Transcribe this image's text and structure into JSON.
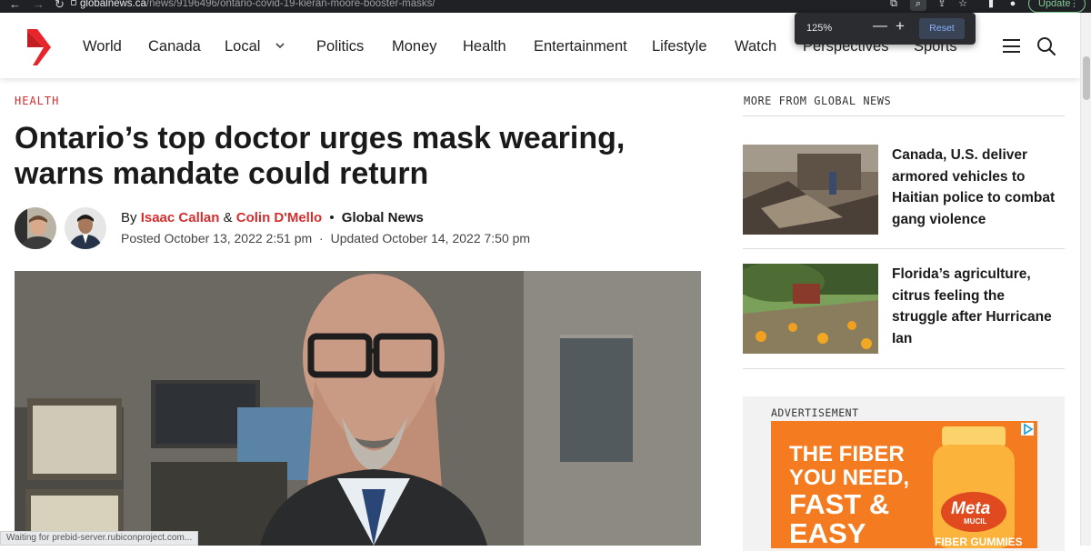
{
  "browser": {
    "url_domain": "globalnews.ca",
    "url_path": "/news/9196496/ontario-covid-19-kieran-moore-booster-masks/",
    "update_label": "Update",
    "zoom_popup": {
      "level": "125%",
      "minus": "—",
      "plus": "+",
      "reset_label": "Reset"
    },
    "status_text": "Waiting for prebid-server.rubiconproject.com..."
  },
  "nav": {
    "items": [
      "World",
      "Canada",
      "Local",
      "Politics",
      "Money",
      "Health",
      "Entertainment",
      "Lifestyle",
      "Watch",
      "Perspectives",
      "Sports"
    ]
  },
  "article": {
    "section": "HEALTH",
    "headline": "Ontario’s top doctor urges mask wearing, warns mandate could return",
    "by_prefix": "By",
    "author1": "Isaac Callan",
    "amp": "&",
    "author2": "Colin D'Mello",
    "bullet": "•",
    "source": "Global News",
    "posted": "Posted October 13, 2022 2:51 pm",
    "separator": "·",
    "updated": "Updated October 14, 2022 7:50 pm"
  },
  "sidebar": {
    "title": "MORE FROM GLOBAL NEWS",
    "stories": [
      {
        "title": "Canada, U.S. deliver armored vehicles to Haitian police to combat gang violence"
      },
      {
        "title": "Florida’s agriculture, citrus feeling the struggle after Hurricane Ian"
      }
    ],
    "ad_label": "ADVERTISEMENT",
    "ad": {
      "line1": "THE FIBER",
      "line2": "YOU NEED,",
      "line3": "FAST &",
      "line4": "EASY",
      "brand": "Meta",
      "brand_sub": "MUCIL",
      "product": "FIBER GUMMIES"
    }
  },
  "colors": {
    "accent_red": "#d32f2f",
    "logo_red": "#e8252b",
    "ad_orange": "#f47b20"
  }
}
